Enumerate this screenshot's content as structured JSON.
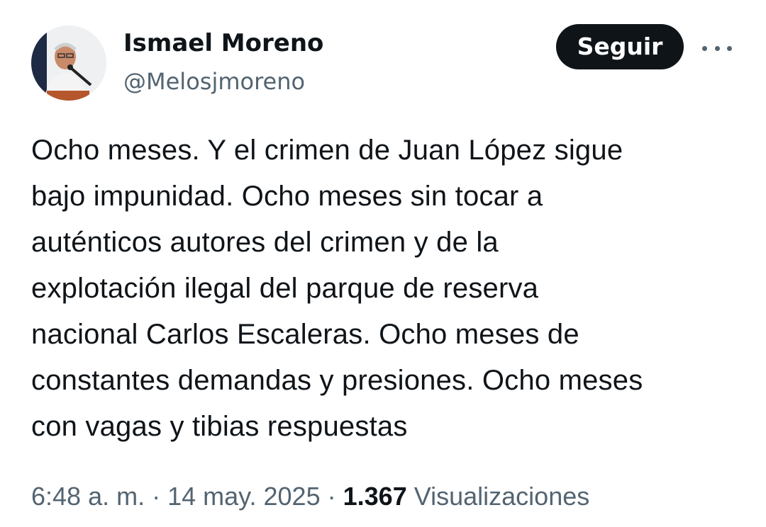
{
  "author": {
    "name": "Ismael Moreno",
    "handle": "@Melosjmoreno",
    "avatar_icon": "profile-photo-speaking-at-microphone"
  },
  "actions": {
    "follow_label": "Seguir",
    "more_icon": "more-horizontal-icon"
  },
  "tweet": {
    "lines": [
      "Ocho meses. Y el crimen de Juan López sigue",
      "bajo impunidad. Ocho meses sin tocar a",
      "auténticos autores del crimen y de la",
      "explotación ilegal del parque de reserva",
      "nacional Carlos Escaleras. Ocho meses de",
      "constantes demandas y presiones. Ocho meses",
      "con vagas y tibias respuestas"
    ]
  },
  "meta": {
    "time": "6:48 a. m.",
    "separator": "·",
    "date": "14 may. 2025",
    "views_count": "1.367",
    "views_label": "Visualizaciones"
  },
  "colors": {
    "text_primary": "#0f1419",
    "text_secondary": "#536471",
    "button_bg": "#0f1419",
    "button_text": "#ffffff",
    "background": "#ffffff"
  }
}
